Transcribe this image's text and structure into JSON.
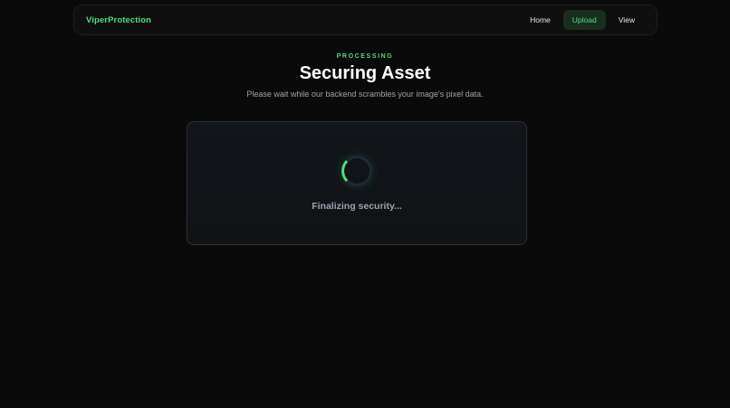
{
  "nav": {
    "brand": "ViperProtection",
    "links": [
      {
        "label": "Home"
      },
      {
        "label": "Upload"
      },
      {
        "label": "View"
      }
    ],
    "active": "Upload"
  },
  "header": {
    "eyebrow": "PROCESSING",
    "title": "Securing Asset",
    "subtitle": "Please wait while our backend scrambles your image's pixel data."
  },
  "card": {
    "status": "Finalizing security..."
  },
  "colors": {
    "accent": "#4ade80",
    "background": "#0a0a0a",
    "card": "#111519"
  }
}
